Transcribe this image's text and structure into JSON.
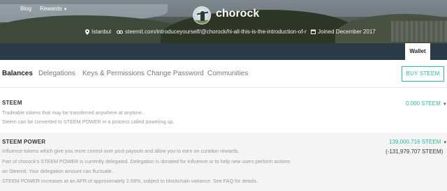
{
  "profile": {
    "username": "chorock",
    "location": "Istanbul",
    "website": "steemit.com/introduceyourself/@chorock/hi-all-this-is-the-introduction-of-me",
    "joined": "Joined December 2017",
    "icons": {
      "location": "map-pin-icon",
      "website": "link-icon",
      "joined": "calendar-icon"
    }
  },
  "nav": {
    "blog": "Blog",
    "rewards": "Rewards",
    "wallet": "Wallet"
  },
  "tabs": [
    {
      "label": "Balances",
      "active": true
    },
    {
      "label": "Delegations",
      "active": false
    },
    {
      "label": "Keys & Permissions",
      "active": false
    },
    {
      "label": "Change Password",
      "active": false
    },
    {
      "label": "Communities",
      "active": false
    }
  ],
  "buy_button": "BUY STEEM",
  "steem": {
    "title": "STEEM",
    "desc1": "Tradeable tokens that may be transferred anywhere at anytime.",
    "desc2": "Steem can be converted to STEEM POWER in a process called powering up.",
    "amount": "0.000 STEEM"
  },
  "steem_power": {
    "title": "STEEM POWER",
    "desc1": "Influence tokens which give you more control over post payouts and allow you to earn on curation rewards.",
    "desc2": "Part of chorock's STEEM POWER is currently delegated. Delegation is donated for influence or to help new users perform actions",
    "desc3": "on Steemit. Your delegation amount can fluctuate.",
    "desc4": "STEEM POWER increases at an APR of approximately 2.69%, subject to blockchain variance. See FAQ for details.",
    "amount": "139,000.716 STEEM",
    "delegated": "(-131,979.707 STEEM)"
  },
  "colors": {
    "accent": "#2bb8a0",
    "navbar": "#2b3a48"
  }
}
